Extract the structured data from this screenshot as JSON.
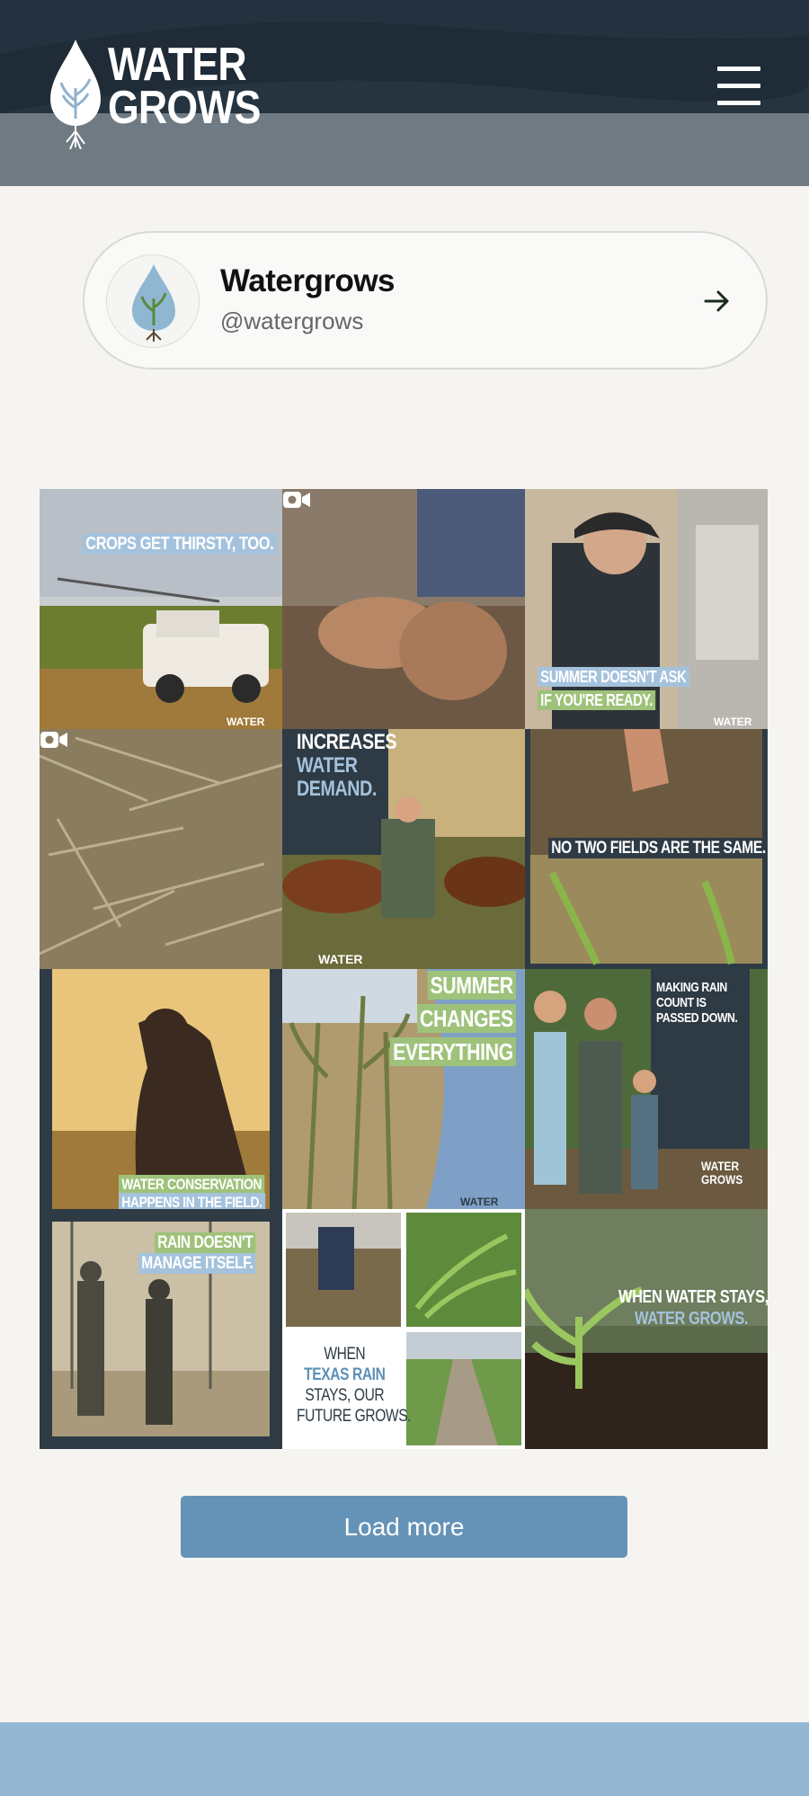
{
  "header": {
    "logo_line1": "WATER",
    "logo_line2": "GROWS",
    "menu_icon": "hamburger-menu-icon"
  },
  "profile": {
    "name": "Watergrows",
    "handle": "@watergrows",
    "arrow_icon": "arrow-right-icon"
  },
  "posts": [
    {
      "caption": "CROPS GET THIRSTY, TOO.",
      "watermark": "WATER"
    },
    {
      "caption": "",
      "icon": "video-camera-icon"
    },
    {
      "caption_line1": "SUMMER DOESN'T ASK",
      "caption_line2": "IF YOU'RE READY.",
      "watermark": "WATER"
    },
    {
      "caption": "",
      "icon": "video-camera-icon"
    },
    {
      "caption_line1": "INCREASES",
      "caption_line2": "WATER",
      "caption_line3": "DEMAND.",
      "watermark": "WATER"
    },
    {
      "caption": "NO TWO FIELDS ARE THE SAME."
    },
    {
      "caption_line1": "WATER CONSERVATION",
      "caption_line2": "HAPPENS IN THE FIELD."
    },
    {
      "caption_line1": "SUMMER",
      "caption_line2": "CHANGES",
      "caption_line3": "EVERYTHING",
      "watermark": "WATER"
    },
    {
      "caption_line1": "MAKING RAIN",
      "caption_line2": "COUNT IS",
      "caption_line3": "PASSED DOWN.",
      "watermark_line1": "WATER",
      "watermark_line2": "GROWS"
    },
    {
      "caption_line1": "RAIN DOESN'T",
      "caption_line2": "MANAGE ITSELF."
    },
    {
      "caption_line1": "WHEN",
      "caption_line2": "TEXAS RAIN",
      "caption_line3": "STAYS, OUR",
      "caption_line4": "FUTURE GROWS."
    },
    {
      "caption_line1": "WHEN WATER STAYS,",
      "caption_line2": "WATER GROWS."
    }
  ],
  "load_more_label": "Load more",
  "colors": {
    "header_dark": "#1f2c37",
    "header_band": "#6f7a82",
    "accent_blue": "#6593b7",
    "footer": "#93b6d3",
    "caption_blue": "#a4c2dc",
    "caption_green": "#9ec27a"
  }
}
